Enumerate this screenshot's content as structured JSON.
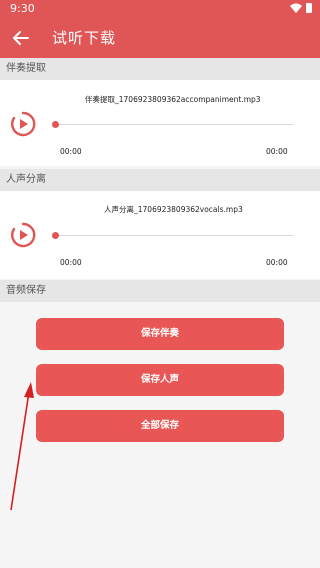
{
  "status": {
    "time": "9:30"
  },
  "appbar": {
    "title": "试听下载",
    "back_icon": "arrow-left-icon"
  },
  "accompaniment": {
    "header": "伴奏提取",
    "file": "伴奏提取_1706923809362accompaniment.mp3",
    "current": "00:00",
    "total": "00:00",
    "progress": 0
  },
  "vocals": {
    "header": "人声分离",
    "file": "人声分离_1706923809362vocals.mp3",
    "current": "00:00",
    "total": "00:00",
    "progress": 0
  },
  "save": {
    "header": "音频保存",
    "buttons": [
      "保存伴奏",
      "保存人声",
      "全部保存"
    ]
  },
  "colors": {
    "accent": "#e05656",
    "button": "#e85656",
    "annotation_arrow": "#d42020"
  }
}
